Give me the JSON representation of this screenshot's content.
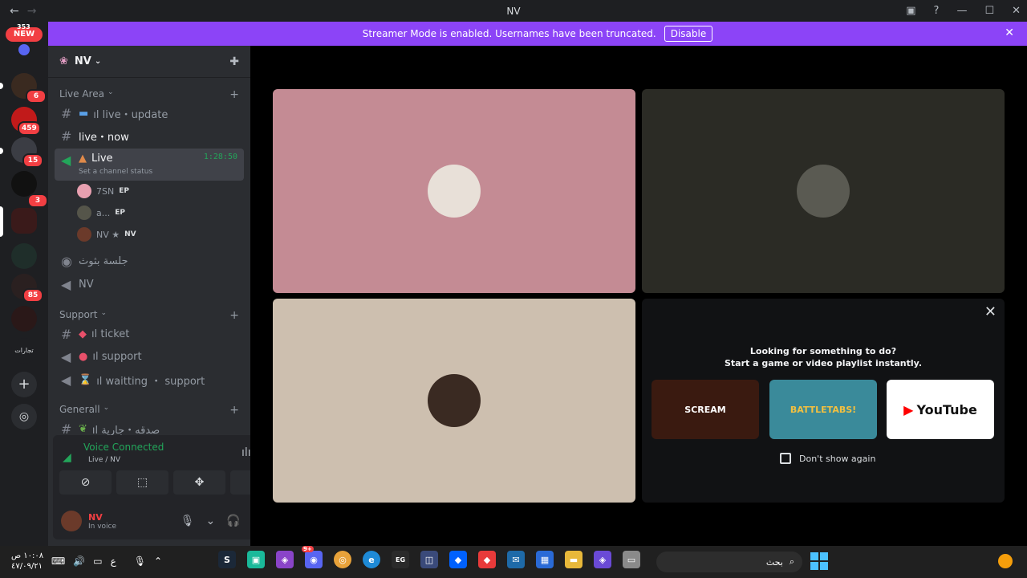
{
  "titlebar": {
    "title": "NV",
    "back": "←",
    "forward": "→"
  },
  "banner": {
    "message": "Streamer Mode is enabled. Usernames have been truncated.",
    "button": "Disable"
  },
  "rail": {
    "new_count": "353",
    "new_label": "NEW",
    "badges": [
      "6",
      "459",
      "15",
      "3",
      "85"
    ],
    "bottom_server_label": "تجارات"
  },
  "server": {
    "name": "NV"
  },
  "categories": [
    {
      "name": "Live Area"
    },
    {
      "name": "Support"
    },
    {
      "name": "Generall"
    }
  ],
  "channels": {
    "live_update": "ıl live・update",
    "live_now": "live・now",
    "live_voice": "Live",
    "live_voice_time": "1:28:50",
    "live_voice_status": "Set a channel status",
    "arabic_voice": "جلسة بثوث",
    "nv_voice": "NV",
    "ticket": "ıl ticket",
    "support": "ıl support",
    "waitting": "ıl waitting ・ support",
    "sadaqa": "ıl صدقه・جارية"
  },
  "voice_users": [
    {
      "name": "7SN",
      "tag": "EP"
    },
    {
      "name": "a...",
      "tag": "EP"
    },
    {
      "name": "NV ★",
      "tag": "NV"
    }
  ],
  "voice_panel": {
    "title": "Voice Connected",
    "subtitle": "Live / NV"
  },
  "user": {
    "name": "NV",
    "status": "In voice"
  },
  "activity": {
    "question_line1": "Looking for something to do?",
    "question_line2": "Start a game or video playlist instantly.",
    "cards": [
      "SCREAM",
      "BATTLETABS!",
      "YouTube"
    ],
    "dont_show": "Don't show again"
  },
  "colors": {
    "tile1": "#c48b94",
    "tile2": "#2b2b25",
    "tile3": "#cdbfaf",
    "banner": "#8c44f7"
  },
  "taskbar": {
    "time": "١٠:٠٨ ص",
    "date": "٤٧/٠٩/٢١",
    "lang": "ع",
    "search_placeholder": "بحث",
    "discord_badge": "9+"
  }
}
